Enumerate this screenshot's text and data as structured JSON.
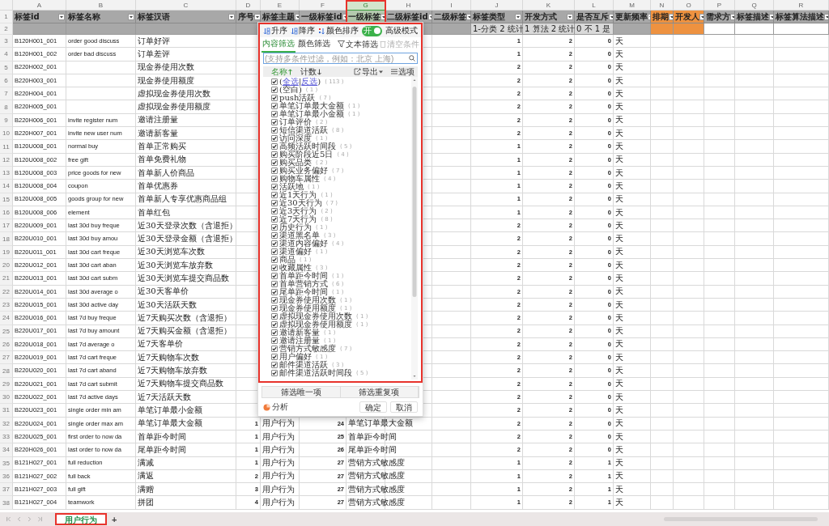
{
  "sheet": {
    "columns": [
      {
        "letter": "A",
        "header": "标签id",
        "color": "#a8a8a8",
        "selected": false,
        "numeric": false,
        "note": {
          "color": "#a8a8a8"
        }
      },
      {
        "letter": "B",
        "header": "标签名称",
        "color": "#a8a8a8",
        "selected": false,
        "numeric": false,
        "note": {
          "color": "#a8a8a8"
        }
      },
      {
        "letter": "C",
        "header": "标签汉语",
        "color": "#a8a8a8",
        "selected": false,
        "numeric": false,
        "note": {
          "color": "#a8a8a8"
        }
      },
      {
        "letter": "D",
        "header": "序号",
        "color": "#a8a8a8",
        "selected": false,
        "numeric": true,
        "note": {
          "color": "#a8a8a8"
        }
      },
      {
        "letter": "E",
        "header": "标签主题",
        "color": "#a8a8a8",
        "selected": false,
        "numeric": false
      },
      {
        "letter": "F",
        "header": "一级标签id",
        "color": "#a8a8a8",
        "selected": false,
        "numeric": true
      },
      {
        "letter": "G",
        "header": "一级标签",
        "color": "#b3c9ad",
        "selected": true,
        "numeric": false
      },
      {
        "letter": "H",
        "header": "二级标签id",
        "color": "#a8a8a8",
        "selected": false,
        "note": {
          "color": "#a8a8a8"
        }
      },
      {
        "letter": "I",
        "header": "二级标签",
        "color": "#a8a8a8",
        "selected": false,
        "note": {
          "color": "#a8a8a8"
        }
      },
      {
        "letter": "J",
        "header": "标签类型",
        "color": "#a8a8a8",
        "selected": false,
        "numeric": true,
        "note": {
          "text": "1-分类 2 统计",
          "color": "#d9d9d9"
        }
      },
      {
        "letter": "K",
        "header": "开发方式",
        "color": "#a8a8a8",
        "selected": false,
        "numeric": true,
        "note": {
          "text": "1 算法 2 统计",
          "color": "#d9d9d9"
        }
      },
      {
        "letter": "L",
        "header": "是否互斥",
        "color": "#a8a8a8",
        "selected": false,
        "numeric": true,
        "note": {
          "text": "0 不 1 是",
          "color": "#d9d9d9"
        }
      },
      {
        "letter": "M",
        "header": "更新频率",
        "color": "#a8a8a8",
        "selected": false,
        "numeric": false,
        "note": {
          "color": "#a8a8a8"
        }
      },
      {
        "letter": "N",
        "header": "排期",
        "color": "#ee9240",
        "selected": false,
        "note": {
          "color": "#ee9240"
        }
      },
      {
        "letter": "O",
        "header": "开发人",
        "color": "#ee9240",
        "selected": false,
        "note": {
          "color": "#ee9240"
        }
      },
      {
        "letter": "P",
        "header": "需求方",
        "color": "#a8a8a8",
        "selected": false,
        "note": {
          "color": "#ffffff"
        }
      },
      {
        "letter": "Q",
        "header": "标签描述",
        "color": "#a8a8a8",
        "selected": false,
        "note": {
          "color": "#ffffff"
        }
      },
      {
        "letter": "R",
        "header": "标签算法描述",
        "color": "#a8a8a8",
        "selected": false,
        "note": {
          "color": "#ffffff"
        }
      }
    ],
    "row_numbers": [
      "1",
      "2"
    ],
    "rows": [
      {
        "num": "3",
        "cells": [
          "B120H001_001",
          "order good discuss",
          "订单好评",
          null,
          null,
          null,
          null,
          null,
          null,
          "1",
          "2",
          "0",
          "天"
        ]
      },
      {
        "num": "4",
        "cells": [
          "B120H001_002",
          "order bad discuss",
          "订单差评",
          null,
          null,
          null,
          null,
          null,
          null,
          "1",
          "2",
          "0",
          "天"
        ]
      },
      {
        "num": "5",
        "cells": [
          "B220H002_001",
          null,
          "现金券使用次数",
          null,
          null,
          null,
          null,
          null,
          null,
          "2",
          "2",
          "0",
          "天"
        ]
      },
      {
        "num": "6",
        "cells": [
          "B220H003_001",
          null,
          "现金券使用额度",
          null,
          null,
          null,
          null,
          null,
          null,
          "2",
          "2",
          "0",
          "天"
        ]
      },
      {
        "num": "7",
        "cells": [
          "B220H004_001",
          null,
          "虚拟现金券使用次数",
          null,
          null,
          null,
          null,
          null,
          null,
          "2",
          "2",
          "0",
          "天"
        ]
      },
      {
        "num": "8",
        "cells": [
          "B220H005_001",
          null,
          "虚拟现金券使用额度",
          null,
          null,
          null,
          null,
          null,
          null,
          "2",
          "2",
          "0",
          "天"
        ]
      },
      {
        "num": "9",
        "cells": [
          "B220H006_001",
          "invite register num",
          "邀请注册量",
          null,
          null,
          null,
          null,
          null,
          null,
          "2",
          "2",
          "0",
          "天"
        ]
      },
      {
        "num": "10",
        "cells": [
          "B220H007_001",
          "invite new user num",
          "邀请新客量",
          null,
          null,
          null,
          null,
          null,
          null,
          "2",
          "2",
          "0",
          "天"
        ]
      },
      {
        "num": "11",
        "cells": [
          "B120U008_001",
          "normal buy",
          "首单正常购买",
          null,
          null,
          null,
          null,
          null,
          null,
          "1",
          "2",
          "0",
          "天"
        ]
      },
      {
        "num": "12",
        "cells": [
          "B120U008_002",
          "free gift",
          "首单免费礼物",
          null,
          null,
          null,
          null,
          null,
          null,
          "1",
          "2",
          "0",
          "天"
        ]
      },
      {
        "num": "13",
        "cells": [
          "B120U008_003",
          "price goods for new",
          "首单新人价商品",
          null,
          null,
          null,
          null,
          null,
          null,
          "1",
          "2",
          "0",
          "天"
        ]
      },
      {
        "num": "14",
        "cells": [
          "B120U008_004",
          "coupon",
          "首单优惠券",
          null,
          null,
          null,
          null,
          null,
          null,
          "1",
          "2",
          "0",
          "天"
        ]
      },
      {
        "num": "15",
        "cells": [
          "B120U008_005",
          "goods group for new",
          "首单新人专享优惠商品组",
          null,
          null,
          null,
          null,
          null,
          null,
          "1",
          "2",
          "0",
          "天"
        ]
      },
      {
        "num": "16",
        "cells": [
          "B120U008_006",
          "element",
          "首单红包",
          null,
          null,
          null,
          null,
          null,
          null,
          "1",
          "2",
          "0",
          "天"
        ]
      },
      {
        "num": "17",
        "cells": [
          "B220U009_001",
          "last 30d buy freque",
          "近30天登录次数（含退拒）",
          null,
          null,
          null,
          null,
          null,
          null,
          "2",
          "2",
          "0",
          "天"
        ]
      },
      {
        "num": "18",
        "cells": [
          "B220U010_001",
          "last 30d buy amou",
          "近30天登录金额（含退拒）",
          null,
          null,
          null,
          null,
          null,
          null,
          "2",
          "2",
          "0",
          "天"
        ]
      },
      {
        "num": "19",
        "cells": [
          "B220U011_001",
          "last 30d cart freque",
          "近30天浏览车次数",
          null,
          null,
          null,
          null,
          null,
          null,
          "2",
          "2",
          "0",
          "天"
        ]
      },
      {
        "num": "20",
        "cells": [
          "B220U012_001",
          "last 30d cart aban",
          "近30天浏览车放弃数",
          null,
          null,
          null,
          null,
          null,
          null,
          "2",
          "2",
          "0",
          "天"
        ]
      },
      {
        "num": "21",
        "cells": [
          "B220U013_001",
          "last 30d cart subm",
          "近30天浏览车提交商品数",
          null,
          null,
          null,
          null,
          null,
          null,
          "2",
          "2",
          "0",
          "天"
        ]
      },
      {
        "num": "22",
        "cells": [
          "B220U014_001",
          "last 30d average o",
          "近30天客单价",
          null,
          null,
          null,
          null,
          null,
          null,
          "2",
          "2",
          "0",
          "天"
        ]
      },
      {
        "num": "23",
        "cells": [
          "B220U015_001",
          "last 30d active day",
          "近30天活跃天数",
          null,
          null,
          null,
          null,
          null,
          null,
          "2",
          "2",
          "0",
          "天"
        ]
      },
      {
        "num": "24",
        "cells": [
          "B220U016_001",
          "last 7d buy freque",
          "近7天购买次数（含退拒）",
          null,
          null,
          null,
          null,
          null,
          null,
          "2",
          "2",
          "0",
          "天"
        ]
      },
      {
        "num": "25",
        "cells": [
          "B220U017_001",
          "last 7d buy amount",
          "近7天购买金额（含退拒）",
          null,
          null,
          null,
          null,
          null,
          null,
          "2",
          "2",
          "0",
          "天"
        ]
      },
      {
        "num": "26",
        "cells": [
          "B220U018_001",
          "last 7d average o",
          "近7天客单价",
          null,
          null,
          null,
          null,
          null,
          null,
          "2",
          "2",
          "0",
          "天"
        ]
      },
      {
        "num": "27",
        "cells": [
          "B220U019_001",
          "last 7d cart freque",
          "近7天购物车次数",
          null,
          null,
          null,
          null,
          null,
          null,
          "2",
          "2",
          "0",
          "天"
        ]
      },
      {
        "num": "28",
        "cells": [
          "B220U020_001",
          "last 7d cart aband",
          "近7天购物车放弃数",
          null,
          null,
          null,
          null,
          null,
          null,
          "2",
          "2",
          "0",
          "天"
        ]
      },
      {
        "num": "29",
        "cells": [
          "B220U021_001",
          "last 7d cart submit",
          "近7天购物车提交商品数",
          null,
          null,
          null,
          null,
          null,
          null,
          "2",
          "2",
          "0",
          "天"
        ]
      },
      {
        "num": "30",
        "cells": [
          "B220U022_001",
          "last 7d active days",
          "近7天活跃天数",
          null,
          null,
          null,
          null,
          null,
          null,
          "2",
          "2",
          "0",
          "天"
        ]
      },
      {
        "num": "31",
        "cells": [
          "B220U023_001",
          "single order min am",
          "单笔订单最小金额",
          null,
          null,
          null,
          null,
          null,
          null,
          "2",
          "2",
          "0",
          "天"
        ]
      },
      {
        "num": "32",
        "cells": [
          "B220U024_001",
          "single order max am",
          "单笔订单最大金额",
          "1",
          "用户行为",
          "24",
          "单笔订单最大金额",
          null,
          null,
          "2",
          "2",
          "0",
          "天"
        ]
      },
      {
        "num": "33",
        "cells": [
          "B220U025_001",
          "first order to now da",
          "首单距今时间",
          "1",
          "用户行为",
          "25",
          "首单距今时间",
          null,
          null,
          "2",
          "2",
          "0",
          "天"
        ]
      },
      {
        "num": "34",
        "cells": [
          "B220H026_001",
          "last order to now da",
          "尾单距今时间",
          "1",
          "用户行为",
          "26",
          "尾单距今时间",
          null,
          null,
          "2",
          "2",
          "0",
          "天"
        ]
      },
      {
        "num": "35",
        "cells": [
          "B121H027_001",
          "full reduction",
          "满减",
          "1",
          "用户行为",
          "27",
          "营销方式敏感度",
          null,
          null,
          "1",
          "2",
          "1",
          "天"
        ]
      },
      {
        "num": "36",
        "cells": [
          "B121H027_002",
          "full back",
          "满返",
          "2",
          "用户行为",
          "27",
          "营销方式敏感度",
          null,
          null,
          "1",
          "2",
          "1",
          "天"
        ]
      },
      {
        "num": "37",
        "cells": [
          "B121H027_003",
          "full gift",
          "满赠",
          "3",
          "用户行为",
          "27",
          "营销方式敏感度",
          null,
          null,
          "1",
          "2",
          "1",
          "天"
        ]
      },
      {
        "num": "38",
        "cells": [
          "B121H027_004",
          "teamwork",
          "拼团",
          "4",
          "用户行为",
          "27",
          "营销方式敏感度",
          null,
          null,
          "1",
          "2",
          "1",
          "天"
        ]
      }
    ]
  },
  "filter_popup": {
    "sort_buttons": [
      "升序",
      "降序",
      "颜色排序"
    ],
    "advanced_mode": {
      "label": "高级模式",
      "toggle_text": "开",
      "on": true
    },
    "tabs": [
      {
        "label": "内容筛选",
        "selected": true
      },
      {
        "label": "颜色筛选",
        "selected": false
      }
    ],
    "text_filter": "文本筛选",
    "clear": {
      "label": "清空条件",
      "disabled": true
    },
    "search": {
      "placeholder": "(支持多条件过滤，例如：北京 上海)"
    },
    "list_header": {
      "name": "名称",
      "count": "计数",
      "export": "导出",
      "options": "选项"
    },
    "select_all": {
      "open": "(",
      "all": "全选",
      "sep": "|",
      "invert": "反选",
      "close": ")",
      "count": "( 113 )",
      "checked": true
    },
    "items": [
      {
        "label": "(空白)",
        "count": "( 1 )",
        "checked": true
      },
      {
        "label": "push活跃",
        "count": "( 7 )",
        "checked": true
      },
      {
        "label": "单笔订单最大金额",
        "count": "( 1 )",
        "checked": true
      },
      {
        "label": "单笔订单最小金额",
        "count": "( 1 )",
        "checked": true
      },
      {
        "label": "订单评价",
        "count": "( 2 )",
        "checked": true
      },
      {
        "label": "短信渠道活跃",
        "count": "( 8 )",
        "checked": true
      },
      {
        "label": "访问深度",
        "count": "( 1 )",
        "checked": true
      },
      {
        "label": "高频活跃时间段",
        "count": "( 5 )",
        "checked": true
      },
      {
        "label": "购买阶段近5日",
        "count": "( 4 )",
        "checked": true
      },
      {
        "label": "购买品类",
        "count": "( 2 )",
        "checked": true
      },
      {
        "label": "购买业务偏好",
        "count": "( 7 )",
        "checked": true
      },
      {
        "label": "购物车属性",
        "count": "( 4 )",
        "checked": true
      },
      {
        "label": "活跃地",
        "count": "( 1 )",
        "checked": true
      },
      {
        "label": "近1天行为",
        "count": "( 1 )",
        "checked": true
      },
      {
        "label": "近30天行为",
        "count": "( 7 )",
        "checked": true
      },
      {
        "label": "近3天行为",
        "count": "( 2 )",
        "checked": true
      },
      {
        "label": "近7天行为",
        "count": "( 8 )",
        "checked": true
      },
      {
        "label": "历史行为",
        "count": "( 1 )",
        "checked": true
      },
      {
        "label": "渠道黑名单",
        "count": "( 3 )",
        "checked": true
      },
      {
        "label": "渠道内容偏好",
        "count": "( 4 )",
        "checked": true
      },
      {
        "label": "渠道偏好",
        "count": "( 1 )",
        "checked": true
      },
      {
        "label": "商品",
        "count": "( 1 )",
        "checked": true
      },
      {
        "label": "收藏属性",
        "count": "( 3 )",
        "checked": true
      },
      {
        "label": "首单距今时间",
        "count": "( 1 )",
        "checked": true
      },
      {
        "label": "首单营销方式",
        "count": "( 6 )",
        "checked": true
      },
      {
        "label": "尾单距今时间",
        "count": "( 1 )",
        "checked": true
      },
      {
        "label": "现金券使用次数",
        "count": "( 1 )",
        "checked": true
      },
      {
        "label": "现金券使用额度",
        "count": "( 1 )",
        "checked": true
      },
      {
        "label": "虚拟现金券使用次数",
        "count": "( 1 )",
        "checked": true
      },
      {
        "label": "虚拟现金券使用额度",
        "count": "( 1 )",
        "checked": true
      },
      {
        "label": "邀请新客量",
        "count": "( 1 )",
        "checked": true
      },
      {
        "label": "邀请注册量",
        "count": "( 1 )",
        "checked": true
      },
      {
        "label": "营销方式敏感度",
        "count": "( 7 )",
        "checked": true
      },
      {
        "label": "用户偏好",
        "count": "( 1 )",
        "checked": true
      },
      {
        "label": "邮件渠道活跃",
        "count": "( 3 )",
        "checked": true
      },
      {
        "label": "邮件渠道活跃时间段",
        "count": "( 5 )",
        "checked": true
      }
    ],
    "footer_buttons": [
      "筛选唯一项",
      "筛选重复项"
    ],
    "analyze": "分析",
    "ok": "确定",
    "cancel": "取消"
  },
  "sheet_tabs": [
    {
      "label": "用户行为",
      "selected": true
    }
  ],
  "add_sheet": "+"
}
